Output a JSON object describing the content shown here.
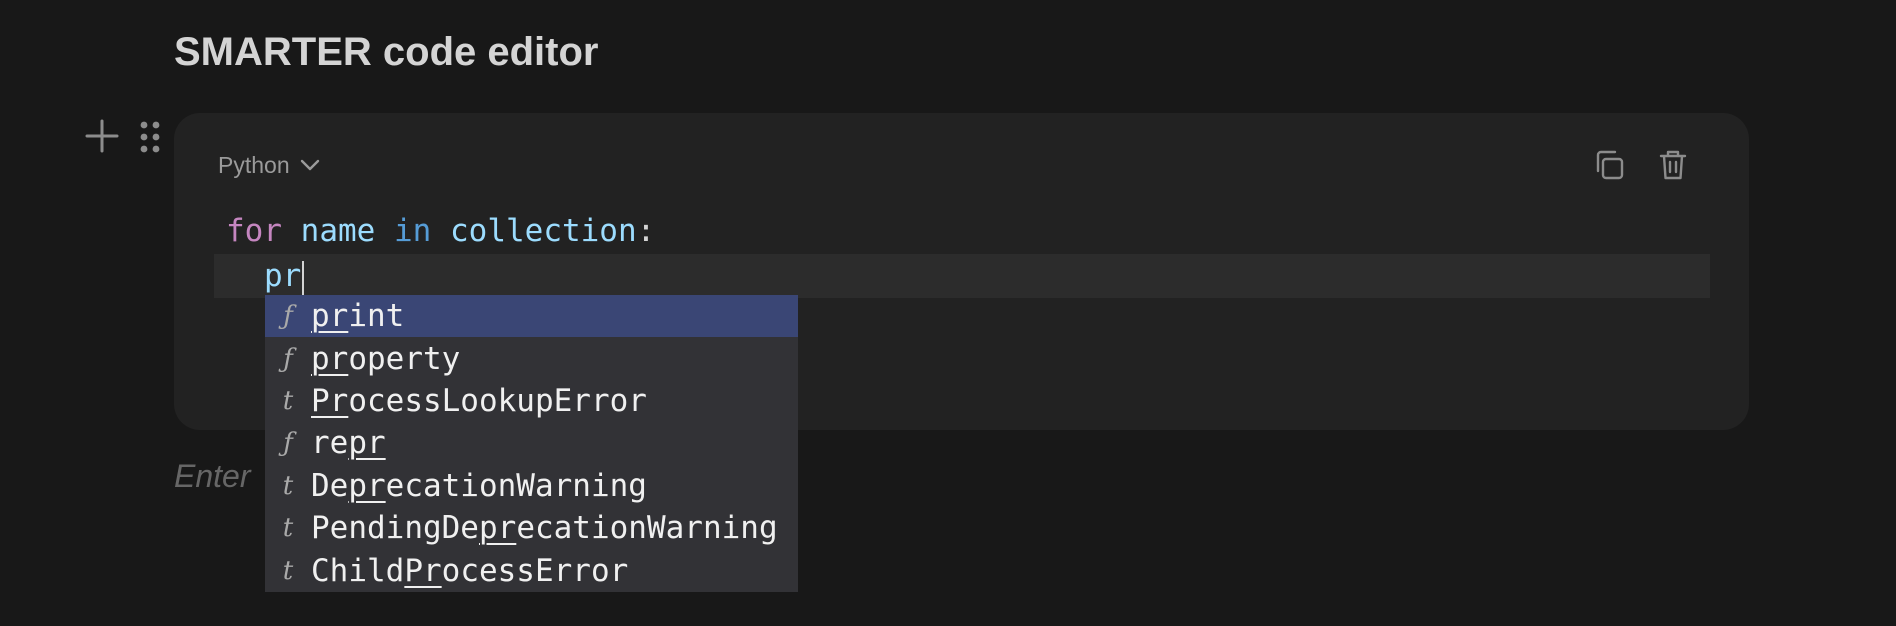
{
  "page": {
    "title": "SMARTER code editor"
  },
  "gutter": {
    "add_icon": "plus-icon",
    "drag_icon": "drag-handle-icon"
  },
  "block": {
    "language": "Python",
    "language_icon": "chevron-down-icon",
    "copy_icon": "copy-icon",
    "delete_icon": "trash-icon"
  },
  "code": {
    "line1": {
      "kw_for": "for",
      "var": "name",
      "kw_in": "in",
      "iter": "collection",
      "colon": ":"
    },
    "line2": {
      "indent": "  ",
      "typed": "pr"
    }
  },
  "placeholder": "Enter",
  "suggestions": [
    {
      "kind": "ƒ",
      "kind_name": "function",
      "before": "",
      "match": "pr",
      "after": "int",
      "selected": true
    },
    {
      "kind": "ƒ",
      "kind_name": "function",
      "before": "",
      "match": "pr",
      "after": "operty",
      "selected": false
    },
    {
      "kind": "t",
      "kind_name": "type",
      "before": "",
      "match": "Pr",
      "after": "ocessLookupError",
      "selected": false
    },
    {
      "kind": "ƒ",
      "kind_name": "function",
      "before": "re",
      "match": "pr",
      "after": "",
      "selected": false
    },
    {
      "kind": "t",
      "kind_name": "type",
      "before": "De",
      "match": "pr",
      "after": "ecationWarning",
      "selected": false
    },
    {
      "kind": "t",
      "kind_name": "type",
      "before": "PendingDe",
      "match": "pr",
      "after": "ecationWarning",
      "selected": false
    },
    {
      "kind": "t",
      "kind_name": "type",
      "before": "Child",
      "match": "Pr",
      "after": "ocessError",
      "selected": false
    }
  ],
  "colors": {
    "background": "#181818",
    "block": "#222222",
    "selected_suggestion": "#3a4675",
    "suggest_bg": "#323236",
    "keyword_for": "#c586c0",
    "keyword_in": "#569cd6",
    "identifier": "#9cdcfe"
  }
}
